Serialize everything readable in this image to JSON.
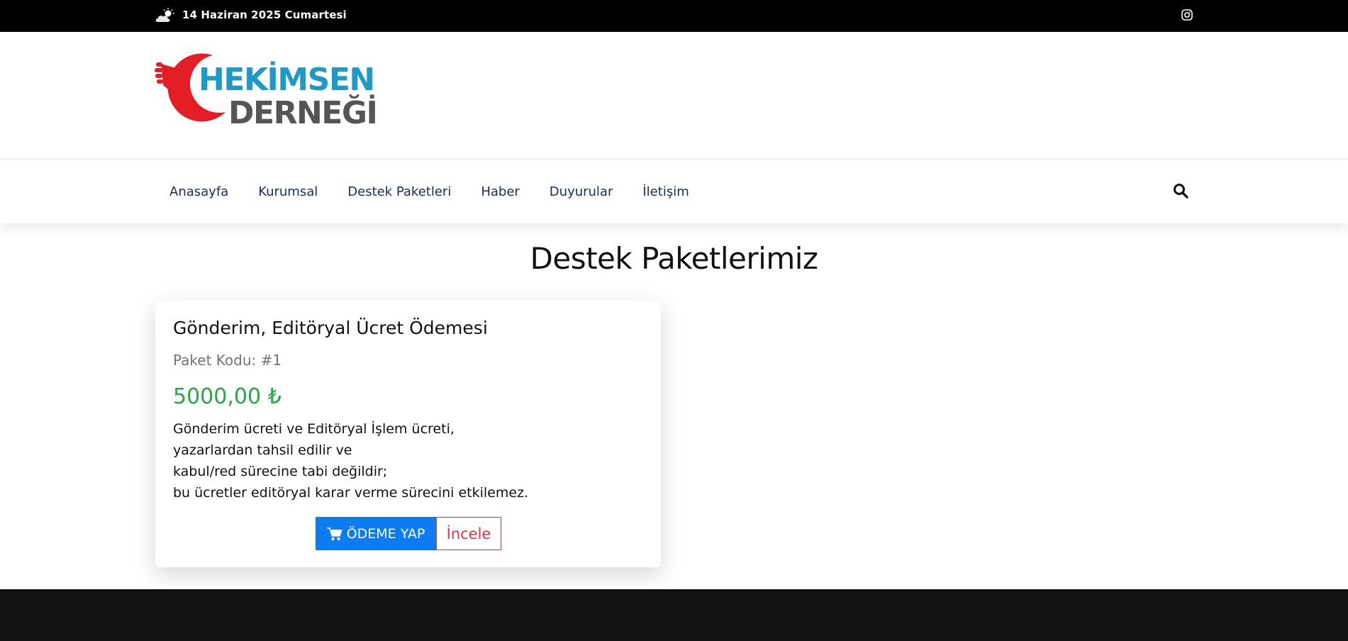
{
  "topbar": {
    "date": "14 Haziran 2025 Cumartesi",
    "weather_icon": "weather-cloud-sun-icon",
    "social_icon": "instagram-icon"
  },
  "logo": {
    "line1": "HEKİMSEN",
    "line2": "DERNEĞİ",
    "colors": {
      "blue": "#1e99c8",
      "red": "#e31e24",
      "gray": "#555555"
    }
  },
  "nav": {
    "items": [
      {
        "label": "Anasayfa"
      },
      {
        "label": "Kurumsal"
      },
      {
        "label": "Destek Paketleri"
      },
      {
        "label": "Haber"
      },
      {
        "label": "Duyurular"
      },
      {
        "label": "İletişim"
      }
    ],
    "search_icon": "search-icon"
  },
  "main": {
    "title": "Destek Paketlerimiz",
    "package": {
      "title": "Gönderim, Editöryal Ücret Ödemesi",
      "code": "Paket Kodu: #1",
      "price": "5000,00 ₺",
      "description": [
        "Gönderim ücreti ve Editöryal İşlem ücreti,",
        "yazarlardan tahsil edilir ve",
        "kabul/red sürecine tabi değildir;",
        "bu ücretler editöryal karar verme sürecini etkilemez."
      ],
      "pay_label": "ÖDEME YAP",
      "pay_icon": "cart-icon",
      "inspect_label": "İncele"
    }
  },
  "colors": {
    "accent": "#0d7cf2",
    "price": "#28a745",
    "danger": "#dc3545",
    "nav_text": "#1a2c53",
    "footer": "#111111"
  }
}
